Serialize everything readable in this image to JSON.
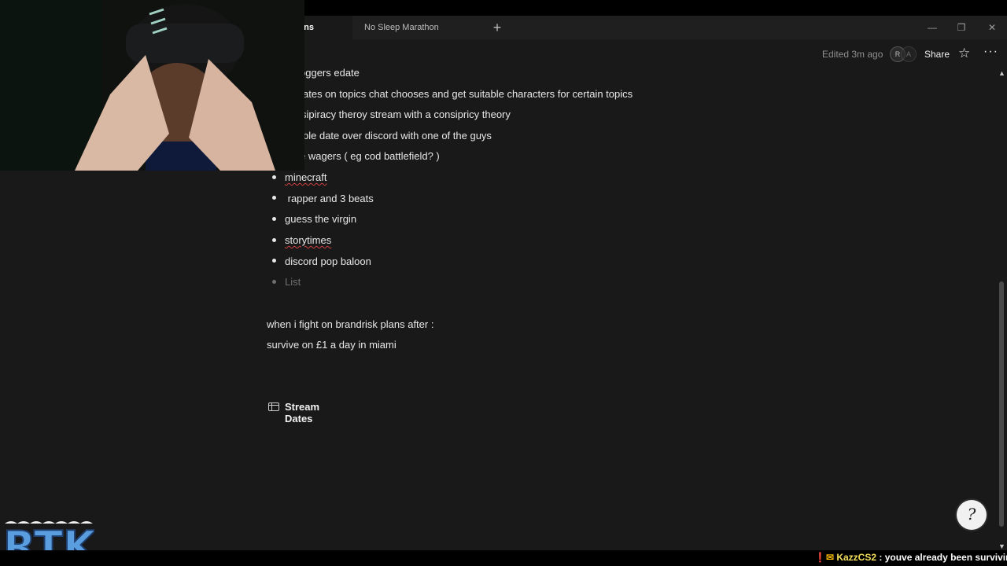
{
  "tabs": [
    {
      "label": "ans",
      "active": true
    },
    {
      "label": "No Sleep Marathon",
      "active": false
    }
  ],
  "window_controls": {
    "minimize": "—",
    "restore": "❐",
    "close": "✕"
  },
  "page_header": {
    "edited": "Edited 3m ago",
    "avatars": [
      "R",
      "A"
    ],
    "share": "Share"
  },
  "content": {
    "lines": [
      "oggers edate",
      "ates on topics chat chooses and get suitable characters for certain topics",
      "sipiracy theroy stream with a consipricy theory",
      "ble date over discord with one of the guys",
      "e wagers ( eg cod battlefield? )"
    ],
    "bullets": [
      "minecraft",
      " rapper and 3 beats",
      "guess the virgin",
      "storytimes",
      "discord pop baloon"
    ],
    "bullet_placeholder": "List",
    "paragraphs": [
      "when i fight on brandrisk plans after :",
      "survive on £1 a day in miami"
    ],
    "database_title": "Stream Dates"
  },
  "overlay": {
    "logo_text": "RTK",
    "chat": {
      "user": "KazzCS2",
      "message": " : youve already been surviving c"
    }
  },
  "colors": {
    "background": "#191919",
    "text": "#e8e8e8",
    "spell_underline": "#d04040"
  }
}
